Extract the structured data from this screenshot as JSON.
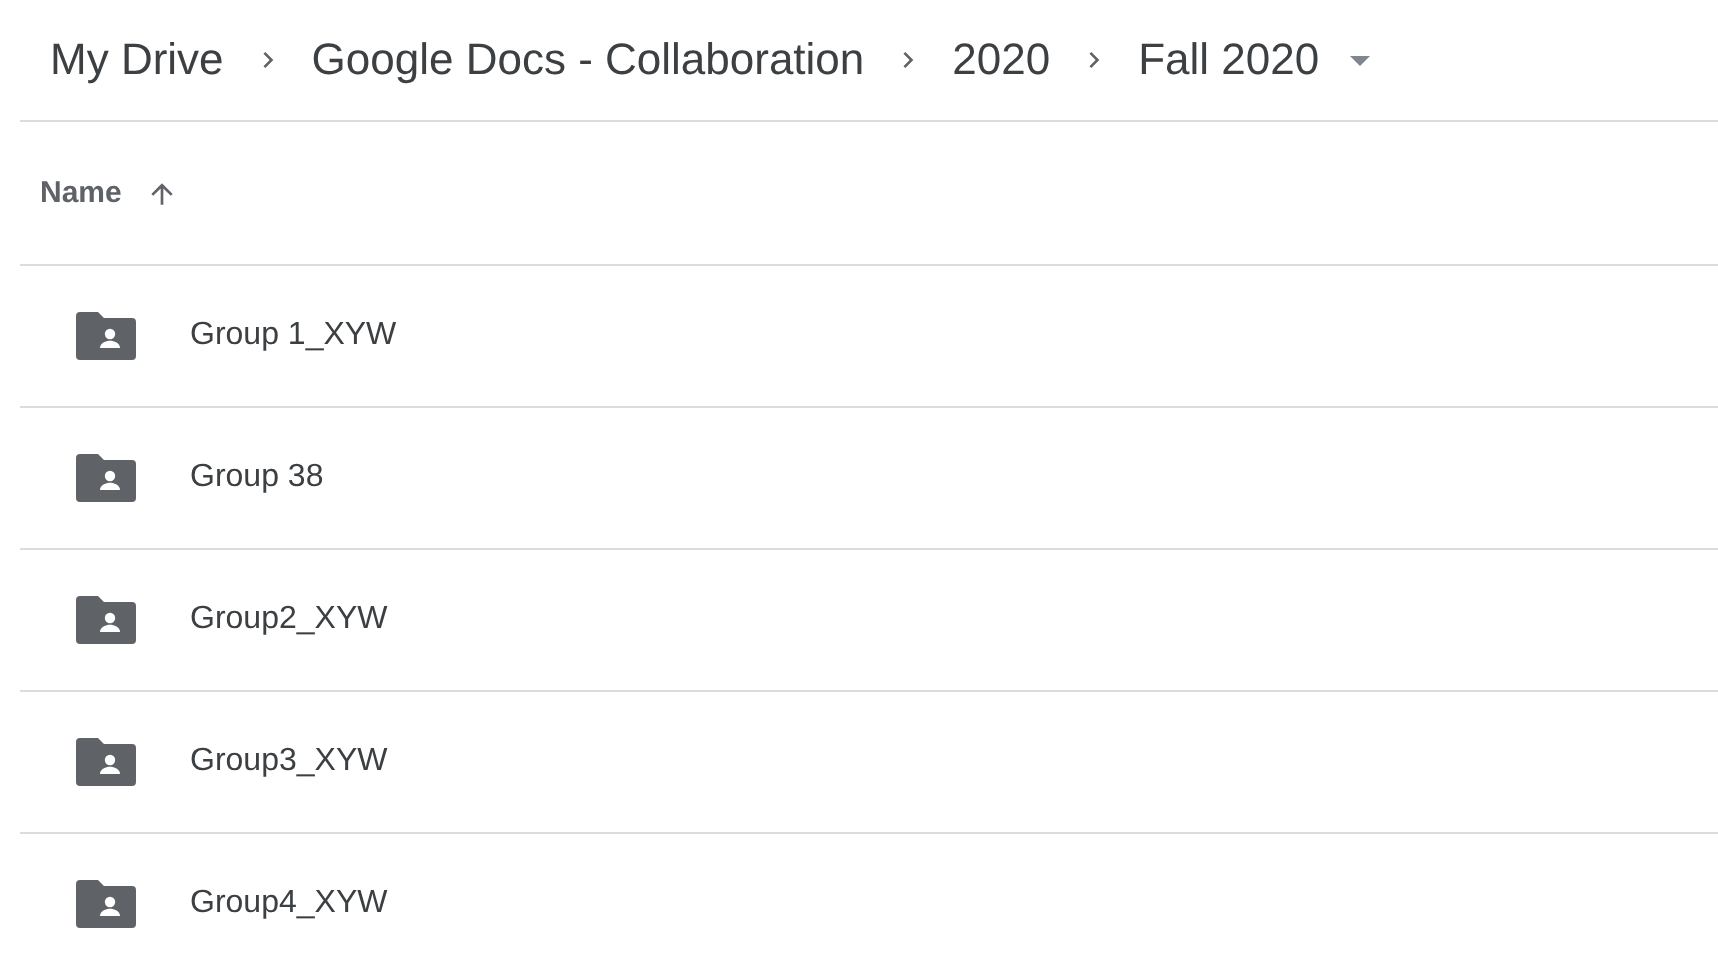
{
  "breadcrumb": [
    {
      "label": "My Drive"
    },
    {
      "label": "Google Docs - Collaboration"
    },
    {
      "label": "2020"
    },
    {
      "label": "Fall 2020",
      "has_menu": true
    }
  ],
  "table": {
    "columns": [
      {
        "label": "Name",
        "sorted_ascending": true
      }
    ],
    "rows": [
      {
        "name": "Group 1_XYW",
        "kind": "shared-folder"
      },
      {
        "name": "Group 38",
        "kind": "shared-folder"
      },
      {
        "name": "Group2_XYW",
        "kind": "shared-folder"
      },
      {
        "name": "Group3_XYW",
        "kind": "shared-folder"
      },
      {
        "name": "Group4_XYW",
        "kind": "shared-folder"
      }
    ]
  }
}
